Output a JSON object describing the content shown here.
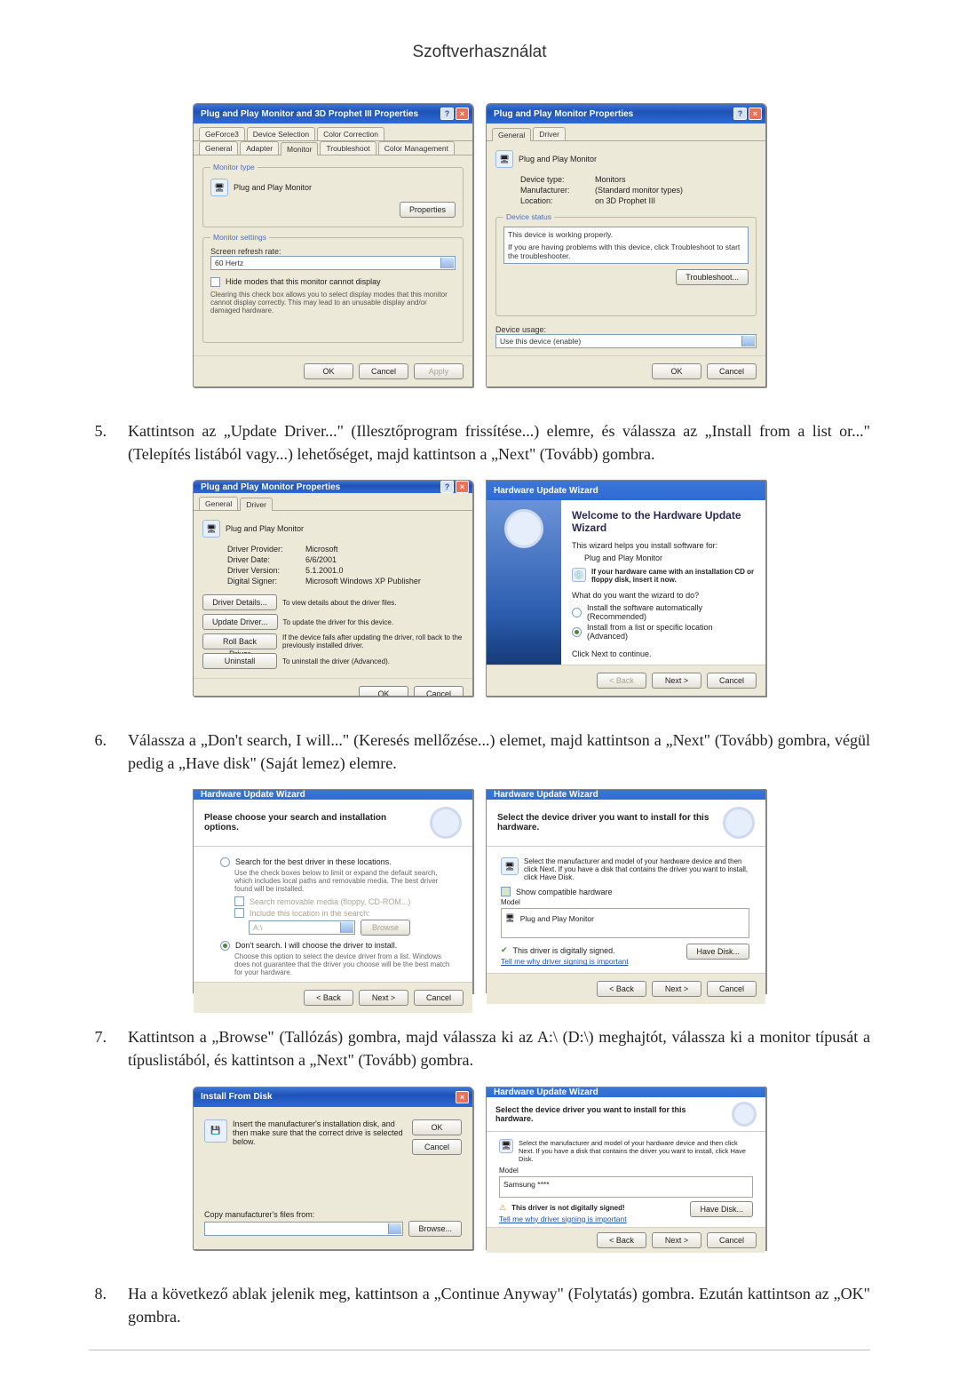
{
  "header": {
    "title": "Szoftverhasználat"
  },
  "dlg1a": {
    "title": "Plug and Play Monitor and 3D Prophet III Properties",
    "tabs_r1": [
      "GeForce3",
      "Device Selection",
      "Color Correction"
    ],
    "tabs_r2": [
      "General",
      "Adapter",
      "Monitor",
      "Troubleshoot",
      "Color Management"
    ],
    "grp_type": "Monitor type",
    "mon_name": "Plug and Play Monitor",
    "props_btn": "Properties",
    "grp_set": "Monitor settings",
    "refresh_lbl": "Screen refresh rate:",
    "refresh_val": "60 Hertz",
    "hide_chk": "Hide modes that this monitor cannot display",
    "hide_desc": "Clearing this check box allows you to select display modes that this monitor cannot display correctly. This may lead to an unusable display and/or damaged hardware.",
    "ok": "OK",
    "cancel": "Cancel",
    "apply": "Apply"
  },
  "dlg1b": {
    "title": "Plug and Play Monitor Properties",
    "tabs": [
      "General",
      "Driver"
    ],
    "head": "Plug and Play Monitor",
    "dt": "Device type:",
    "dt_v": "Monitors",
    "mf": "Manufacturer:",
    "mf_v": "(Standard monitor types)",
    "loc": "Location:",
    "loc_v": "on 3D Prophet III",
    "status_grp": "Device status",
    "status1": "This device is working properly.",
    "status2": "If you are having problems with this device, click Troubleshoot to start the troubleshooter.",
    "trbl": "Troubleshoot...",
    "usage_lbl": "Device usage:",
    "usage_val": "Use this device (enable)",
    "ok": "OK",
    "cancel": "Cancel"
  },
  "step5": {
    "num": "5.",
    "txt": "Kattintson az „Update Driver...\" (Illesztőprogram frissítése...) elemre, és válassza az „Install from a list or...\" (Telepítés listából vagy...) lehetőséget, majd kattintson a „Next\" (Tovább) gombra."
  },
  "dlg2a": {
    "title": "Plug and Play Monitor Properties",
    "tabs": [
      "General",
      "Driver"
    ],
    "head": "Plug and Play Monitor",
    "prov_l": "Driver Provider:",
    "prov_v": "Microsoft",
    "date_l": "Driver Date:",
    "date_v": "6/6/2001",
    "ver_l": "Driver Version:",
    "ver_v": "5.1.2001.0",
    "sig_l": "Digital Signer:",
    "sig_v": "Microsoft Windows XP Publisher",
    "bd": "Driver Details...",
    "bd_d": "To view details about the driver files.",
    "bu": "Update Driver...",
    "bu_d": "To update the driver for this device.",
    "br": "Roll Back Driver",
    "br_d": "If the device fails after updating the driver, roll back to the previously installed driver.",
    "bx": "Uninstall",
    "bx_d": "To uninstall the driver (Advanced).",
    "ok": "OK",
    "cancel": "Cancel"
  },
  "dlg2b": {
    "title": "Hardware Update Wizard",
    "h": "Welcome to the Hardware Update Wizard",
    "p1": "This wizard helps you install software for:",
    "p2": "Plug and Play Monitor",
    "cd": "If your hardware came with an installation CD or floppy disk, insert it now.",
    "q": "What do you want the wizard to do?",
    "r1": "Install the software automatically (Recommended)",
    "r2": "Install from a list or specific location (Advanced)",
    "cont": "Click Next to continue.",
    "back": "< Back",
    "next": "Next >",
    "cancel": "Cancel"
  },
  "step6": {
    "num": "6.",
    "txt": "Válassza a „Don't search, I will...\" (Keresés mellőzése...) elemet, majd kattintson a „Next\" (Tovább) gombra, végül pedig a „Have disk\" (Saját lemez) elemre."
  },
  "dlg3a": {
    "title": "Hardware Update Wizard",
    "h": "Please choose your search and installation options.",
    "r1": "Search for the best driver in these locations.",
    "r1d": "Use the check boxes below to limit or expand the default search, which includes local paths and removable media. The best driver found will be installed.",
    "c1": "Search removable media (floppy, CD-ROM...)",
    "c2": "Include this location in the search:",
    "path": "A:\\",
    "browse": "Browse",
    "r2": "Don't search. I will choose the driver to install.",
    "r2d": "Choose this option to select the device driver from a list. Windows does not guarantee that the driver you choose will be the best match for your hardware.",
    "back": "< Back",
    "next": "Next >",
    "cancel": "Cancel"
  },
  "dlg3b": {
    "title": "Hardware Update Wizard",
    "h": "Select the device driver you want to install for this hardware.",
    "desc": "Select the manufacturer and model of your hardware device and then click Next. If you have a disk that contains the driver you want to install, click Have Disk.",
    "compat": "Show compatible hardware",
    "model_lbl": "Model",
    "model": "Plug and Play Monitor",
    "signed": "This driver is digitally signed.",
    "why": "Tell me why driver signing is important",
    "havedisk": "Have Disk...",
    "back": "< Back",
    "next": "Next >",
    "cancel": "Cancel"
  },
  "step7": {
    "num": "7.",
    "txt": "Kattintson a „Browse\" (Tallózás) gombra, majd válassza ki az A:\\ (D:\\) meghajtót, válassza ki a monitor típusát a típuslistából, és kattintson a „Next\" (Tovább) gombra."
  },
  "dlg4a": {
    "title": "Install From Disk",
    "msg": "Insert the manufacturer's installation disk, and then make sure that the correct drive is selected below.",
    "ok": "OK",
    "cancel": "Cancel",
    "copy": "Copy manufacturer's files from:",
    "browse": "Browse..."
  },
  "dlg4b": {
    "title": "Hardware Update Wizard",
    "h": "Select the device driver you want to install for this hardware.",
    "desc": "Select the manufacturer and model of your hardware device and then click Next. If you have a disk that contains the driver you want to install, click Have Disk.",
    "model_lbl": "Model",
    "model": "Samsung ****",
    "notsigned": "This driver is not digitally signed!",
    "why": "Tell me why driver signing is important",
    "havedisk": "Have Disk...",
    "back": "< Back",
    "next": "Next >",
    "cancel": "Cancel"
  },
  "step8": {
    "num": "8.",
    "txt": "Ha a következő ablak jelenik meg, kattintson a „Continue Anyway\" (Folytatás) gombra. Ezután kattintson az „OK\" gombra."
  }
}
